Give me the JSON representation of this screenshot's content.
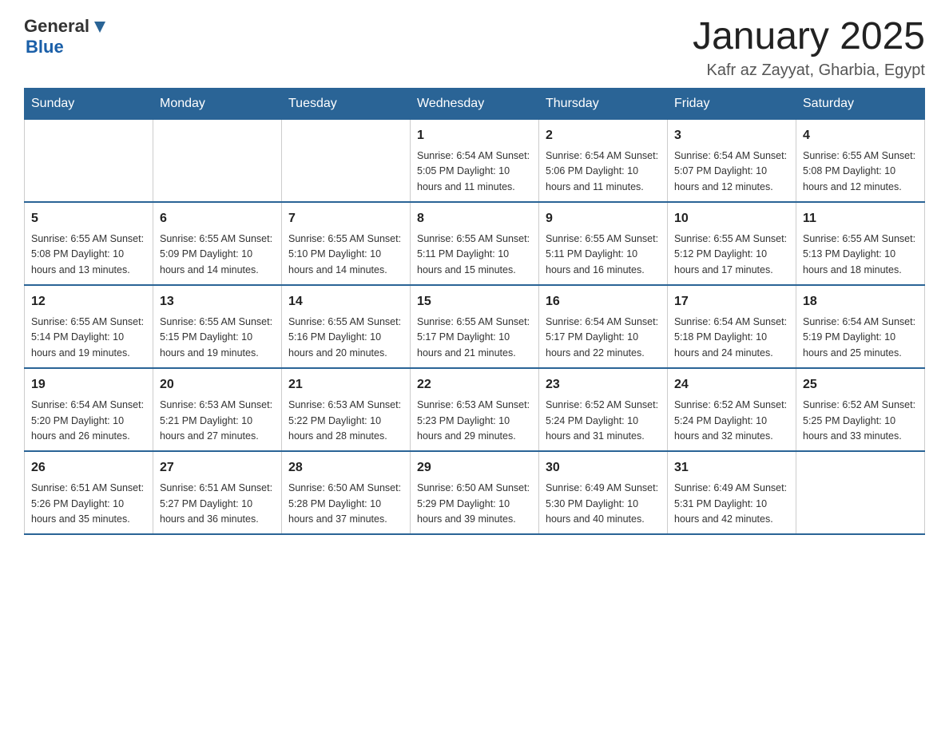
{
  "header": {
    "logo": {
      "text_general": "General",
      "text_blue": "Blue"
    },
    "title": "January 2025",
    "subtitle": "Kafr az Zayyat, Gharbia, Egypt"
  },
  "days_of_week": [
    "Sunday",
    "Monday",
    "Tuesday",
    "Wednesday",
    "Thursday",
    "Friday",
    "Saturday"
  ],
  "weeks": [
    [
      {
        "day": "",
        "info": ""
      },
      {
        "day": "",
        "info": ""
      },
      {
        "day": "",
        "info": ""
      },
      {
        "day": "1",
        "info": "Sunrise: 6:54 AM\nSunset: 5:05 PM\nDaylight: 10 hours\nand 11 minutes."
      },
      {
        "day": "2",
        "info": "Sunrise: 6:54 AM\nSunset: 5:06 PM\nDaylight: 10 hours\nand 11 minutes."
      },
      {
        "day": "3",
        "info": "Sunrise: 6:54 AM\nSunset: 5:07 PM\nDaylight: 10 hours\nand 12 minutes."
      },
      {
        "day": "4",
        "info": "Sunrise: 6:55 AM\nSunset: 5:08 PM\nDaylight: 10 hours\nand 12 minutes."
      }
    ],
    [
      {
        "day": "5",
        "info": "Sunrise: 6:55 AM\nSunset: 5:08 PM\nDaylight: 10 hours\nand 13 minutes."
      },
      {
        "day": "6",
        "info": "Sunrise: 6:55 AM\nSunset: 5:09 PM\nDaylight: 10 hours\nand 14 minutes."
      },
      {
        "day": "7",
        "info": "Sunrise: 6:55 AM\nSunset: 5:10 PM\nDaylight: 10 hours\nand 14 minutes."
      },
      {
        "day": "8",
        "info": "Sunrise: 6:55 AM\nSunset: 5:11 PM\nDaylight: 10 hours\nand 15 minutes."
      },
      {
        "day": "9",
        "info": "Sunrise: 6:55 AM\nSunset: 5:11 PM\nDaylight: 10 hours\nand 16 minutes."
      },
      {
        "day": "10",
        "info": "Sunrise: 6:55 AM\nSunset: 5:12 PM\nDaylight: 10 hours\nand 17 minutes."
      },
      {
        "day": "11",
        "info": "Sunrise: 6:55 AM\nSunset: 5:13 PM\nDaylight: 10 hours\nand 18 minutes."
      }
    ],
    [
      {
        "day": "12",
        "info": "Sunrise: 6:55 AM\nSunset: 5:14 PM\nDaylight: 10 hours\nand 19 minutes."
      },
      {
        "day": "13",
        "info": "Sunrise: 6:55 AM\nSunset: 5:15 PM\nDaylight: 10 hours\nand 19 minutes."
      },
      {
        "day": "14",
        "info": "Sunrise: 6:55 AM\nSunset: 5:16 PM\nDaylight: 10 hours\nand 20 minutes."
      },
      {
        "day": "15",
        "info": "Sunrise: 6:55 AM\nSunset: 5:17 PM\nDaylight: 10 hours\nand 21 minutes."
      },
      {
        "day": "16",
        "info": "Sunrise: 6:54 AM\nSunset: 5:17 PM\nDaylight: 10 hours\nand 22 minutes."
      },
      {
        "day": "17",
        "info": "Sunrise: 6:54 AM\nSunset: 5:18 PM\nDaylight: 10 hours\nand 24 minutes."
      },
      {
        "day": "18",
        "info": "Sunrise: 6:54 AM\nSunset: 5:19 PM\nDaylight: 10 hours\nand 25 minutes."
      }
    ],
    [
      {
        "day": "19",
        "info": "Sunrise: 6:54 AM\nSunset: 5:20 PM\nDaylight: 10 hours\nand 26 minutes."
      },
      {
        "day": "20",
        "info": "Sunrise: 6:53 AM\nSunset: 5:21 PM\nDaylight: 10 hours\nand 27 minutes."
      },
      {
        "day": "21",
        "info": "Sunrise: 6:53 AM\nSunset: 5:22 PM\nDaylight: 10 hours\nand 28 minutes."
      },
      {
        "day": "22",
        "info": "Sunrise: 6:53 AM\nSunset: 5:23 PM\nDaylight: 10 hours\nand 29 minutes."
      },
      {
        "day": "23",
        "info": "Sunrise: 6:52 AM\nSunset: 5:24 PM\nDaylight: 10 hours\nand 31 minutes."
      },
      {
        "day": "24",
        "info": "Sunrise: 6:52 AM\nSunset: 5:24 PM\nDaylight: 10 hours\nand 32 minutes."
      },
      {
        "day": "25",
        "info": "Sunrise: 6:52 AM\nSunset: 5:25 PM\nDaylight: 10 hours\nand 33 minutes."
      }
    ],
    [
      {
        "day": "26",
        "info": "Sunrise: 6:51 AM\nSunset: 5:26 PM\nDaylight: 10 hours\nand 35 minutes."
      },
      {
        "day": "27",
        "info": "Sunrise: 6:51 AM\nSunset: 5:27 PM\nDaylight: 10 hours\nand 36 minutes."
      },
      {
        "day": "28",
        "info": "Sunrise: 6:50 AM\nSunset: 5:28 PM\nDaylight: 10 hours\nand 37 minutes."
      },
      {
        "day": "29",
        "info": "Sunrise: 6:50 AM\nSunset: 5:29 PM\nDaylight: 10 hours\nand 39 minutes."
      },
      {
        "day": "30",
        "info": "Sunrise: 6:49 AM\nSunset: 5:30 PM\nDaylight: 10 hours\nand 40 minutes."
      },
      {
        "day": "31",
        "info": "Sunrise: 6:49 AM\nSunset: 5:31 PM\nDaylight: 10 hours\nand 42 minutes."
      },
      {
        "day": "",
        "info": ""
      }
    ]
  ]
}
